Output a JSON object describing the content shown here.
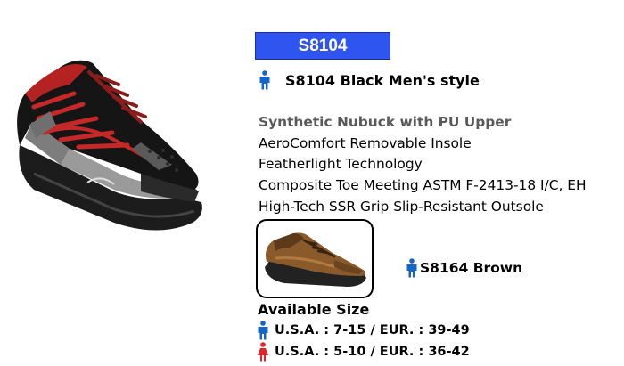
{
  "product": {
    "badge": "S8104",
    "title": "S8104 Black Men's style",
    "features": [
      "Synthetic Nubuck with PU Upper",
      "AeroComfort  Removable  Insole",
      "Featherlight Technology",
      "Composite Toe Meeting ASTM F-2413-18 I/C, EH",
      "High-Tech SSR Grip Slip-Resistant Outsole"
    ]
  },
  "alternate": {
    "label": "S8164 Brown"
  },
  "sizes": {
    "heading": "Available Size",
    "men": "U.S.A. : 7-15 / EUR. : 39-49",
    "women": "U.S.A. : 5-10 / EUR. : 36-42"
  },
  "icons": {
    "men": "man-icon",
    "women": "woman-icon"
  },
  "colors": {
    "badge_bg": "#2f55f0",
    "men_icon": "#1565c8",
    "women_icon": "#e0262b"
  }
}
